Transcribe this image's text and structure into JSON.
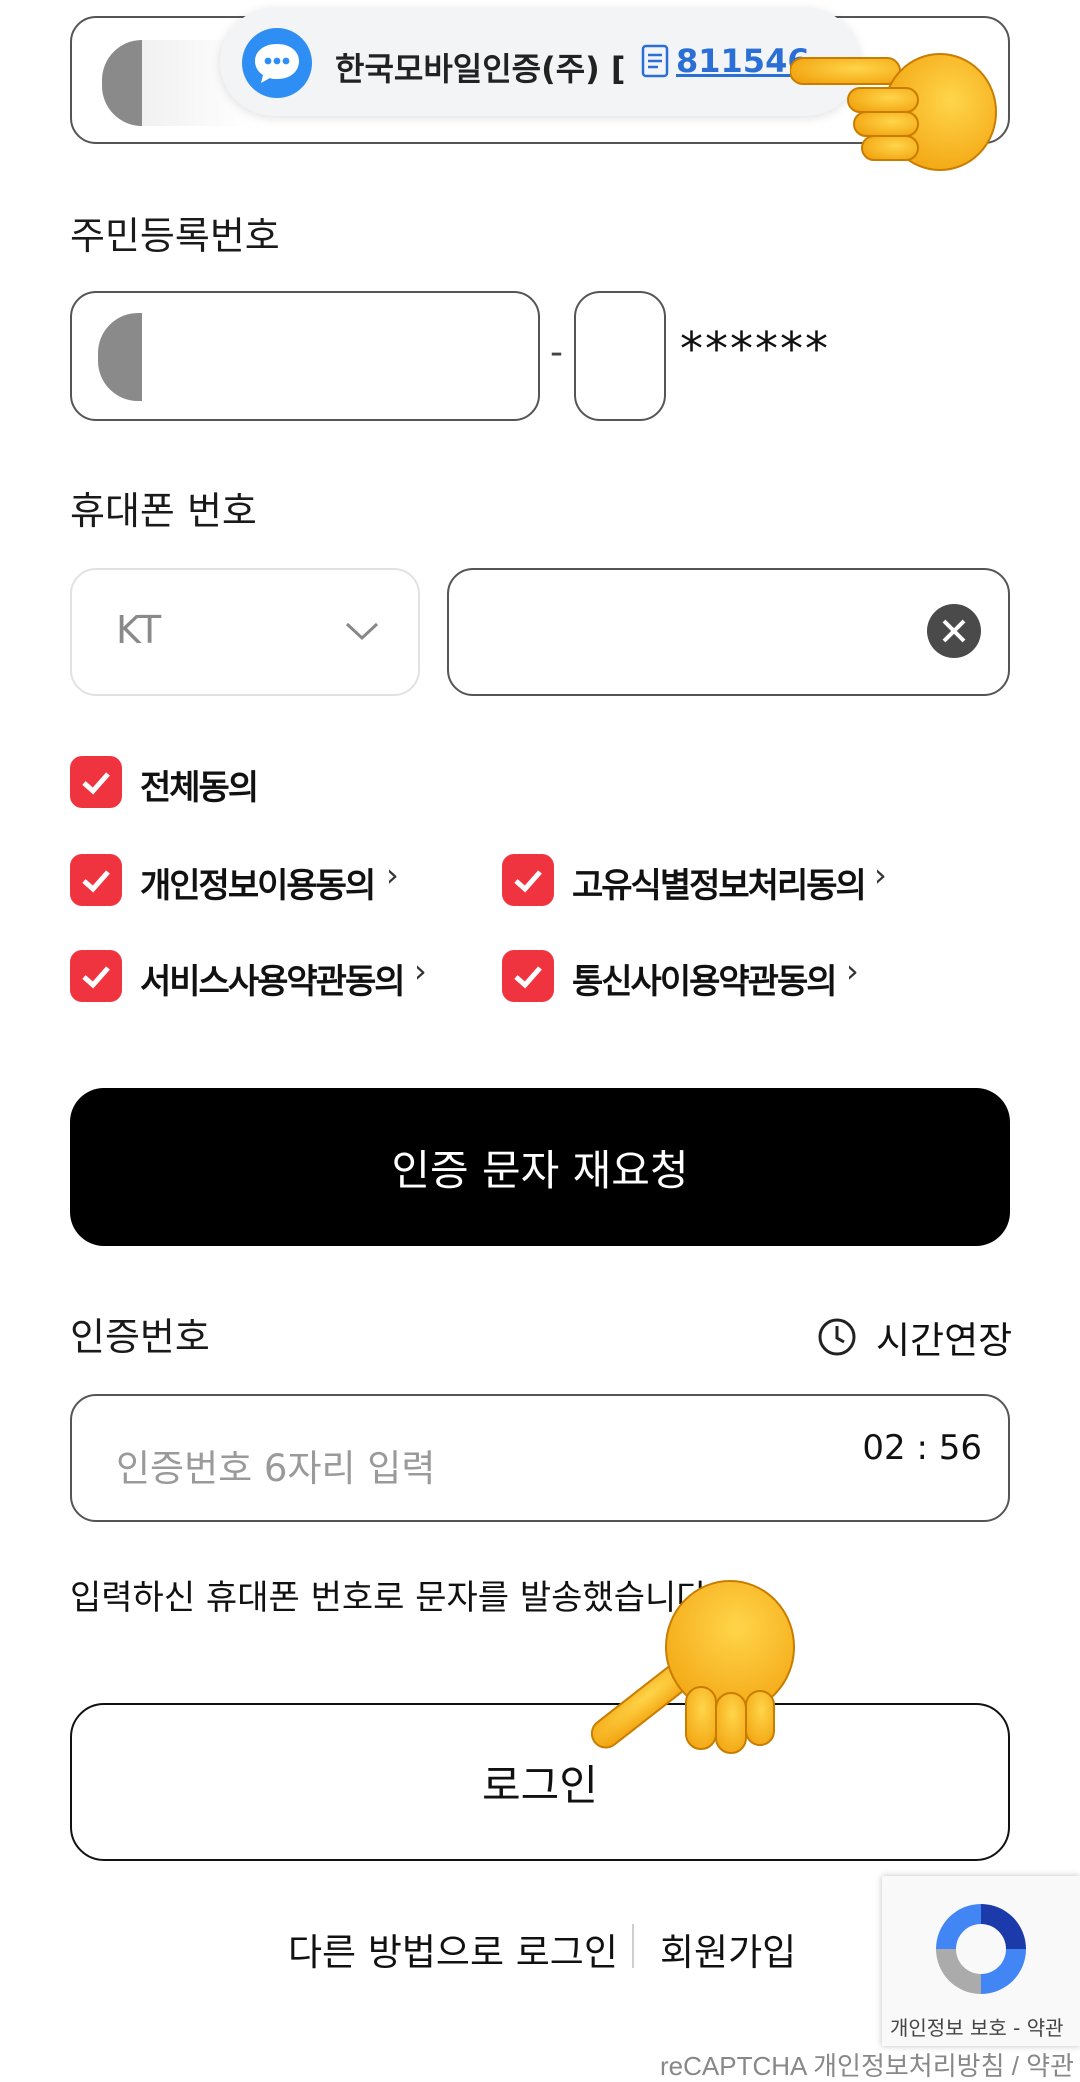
{
  "sms_banner": {
    "sender": "한국모바일인증(주) [",
    "code": "811546"
  },
  "rrn": {
    "label": "주민등록번호",
    "separator": "-",
    "masked": "******"
  },
  "phone": {
    "label": "휴대폰 번호",
    "carrier": "KT"
  },
  "agreements": {
    "all": "전체동의",
    "items": [
      "개인정보이용동의",
      "고유식별정보처리동의",
      "서비스사용약관동의",
      "통신사이용약관동의"
    ],
    "chevron": "›"
  },
  "resend_button": "인증 문자 재요청",
  "verification": {
    "label": "인증번호",
    "extend_label": "시간연장",
    "placeholder": "인증번호 6자리 입력",
    "timer": "02 : 56",
    "sent_message": "입력하신 휴대폰 번호로 문자를 발송했습니다"
  },
  "login_button": "로그인",
  "footer_links": {
    "other_login": "다른 방법으로 로그인",
    "signup": "회원가입"
  },
  "recaptcha": {
    "badge_links": "개인정보 보호 - 약관",
    "footer": "reCAPTCHA 개인정보처리방침 / 약관"
  },
  "colors": {
    "accent_red": "#f0343f",
    "sms_blue": "#2f8ef3",
    "code_link": "#2a6fd6"
  }
}
